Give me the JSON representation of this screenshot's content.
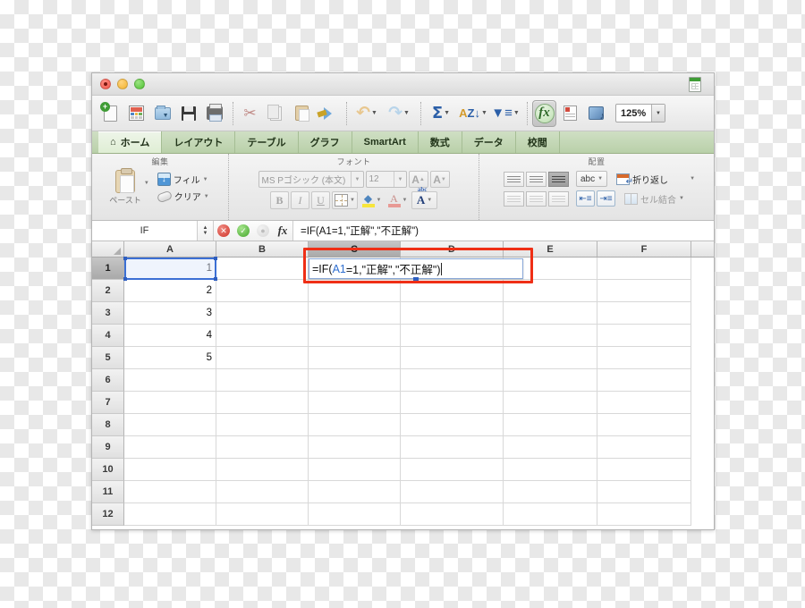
{
  "window": {
    "traffic_lights": [
      "close",
      "minimize",
      "zoom"
    ],
    "proxy_icon": "excel-document-icon"
  },
  "toolbar": {
    "items": [
      {
        "name": "new-document-button",
        "icon": "new-document-icon",
        "label": ""
      },
      {
        "name": "template-gallery-button",
        "icon": "gallery-icon",
        "label": ""
      },
      {
        "name": "open-button",
        "icon": "open-folder-icon",
        "label": ""
      },
      {
        "name": "save-button",
        "icon": "save-icon",
        "label": ""
      },
      {
        "name": "print-button",
        "icon": "print-icon",
        "label": ""
      },
      {
        "name": "cut-button",
        "icon": "scissors-icon",
        "label": ""
      },
      {
        "name": "copy-button",
        "icon": "copy-icon",
        "label": ""
      },
      {
        "name": "paste-button",
        "icon": "paste-icon",
        "label": ""
      },
      {
        "name": "format-painter-button",
        "icon": "paintbrush-icon",
        "label": ""
      },
      {
        "name": "undo-button",
        "icon": "undo-arrow-icon",
        "label": ""
      },
      {
        "name": "redo-button",
        "icon": "redo-arrow-icon",
        "label": ""
      },
      {
        "name": "autosum-button",
        "icon": "sigma-icon",
        "label": ""
      },
      {
        "name": "sort-button",
        "icon": "sort-az-icon",
        "label": ""
      },
      {
        "name": "filter-button",
        "icon": "funnel-icon",
        "label": ""
      },
      {
        "name": "formula-builder-button",
        "icon": "fx-icon",
        "label": ""
      },
      {
        "name": "toolbox-button",
        "icon": "toolbox-icon",
        "label": ""
      },
      {
        "name": "media-browser-button",
        "icon": "media-browser-icon",
        "label": ""
      }
    ],
    "zoom_value": "125%"
  },
  "ribbon": {
    "tabs": [
      {
        "label": "ホーム",
        "active": true,
        "icon": "home-icon"
      },
      {
        "label": "レイアウト",
        "active": false
      },
      {
        "label": "テーブル",
        "active": false
      },
      {
        "label": "グラフ",
        "active": false
      },
      {
        "label": "SmartArt",
        "active": false
      },
      {
        "label": "数式",
        "active": false
      },
      {
        "label": "データ",
        "active": false
      },
      {
        "label": "校閲",
        "active": false
      }
    ],
    "groups": {
      "edit": {
        "title": "編集",
        "paste_label": "ペースト",
        "fill_label": "フィル",
        "clear_label": "クリア"
      },
      "font": {
        "title": "フォント",
        "font_name": "MS Pゴシック (本文)",
        "font_size": "12",
        "grow_label": "A",
        "shrink_label": "A",
        "bold_label": "B",
        "italic_label": "I",
        "underline_label": "U"
      },
      "alignment": {
        "title": "配置",
        "orientation_label": "abc",
        "wrap_label": "折り返し",
        "merge_label": "セル結合"
      }
    }
  },
  "formula_bar": {
    "name_box": "IF",
    "cancel_icon": "cancel-x-icon",
    "accept_icon": "accept-check-icon",
    "fx_icon": "fx-icon",
    "formula": "=IF(A1=1,\"正解\",\"不正解\")"
  },
  "sheet": {
    "columns": [
      "A",
      "B",
      "C",
      "D",
      "E",
      "F"
    ],
    "selected_column": "C",
    "selected_row": "1",
    "rows": [
      {
        "num": "1",
        "cells": [
          "1",
          "",
          "",
          "",
          "",
          ""
        ]
      },
      {
        "num": "2",
        "cells": [
          "2",
          "",
          "",
          "",
          "",
          ""
        ]
      },
      {
        "num": "3",
        "cells": [
          "3",
          "",
          "",
          "",
          "",
          ""
        ]
      },
      {
        "num": "4",
        "cells": [
          "4",
          "",
          "",
          "",
          "",
          ""
        ]
      },
      {
        "num": "5",
        "cells": [
          "5",
          "",
          "",
          "",
          "",
          ""
        ]
      },
      {
        "num": "6",
        "cells": [
          "",
          "",
          "",
          "",
          "",
          ""
        ]
      },
      {
        "num": "7",
        "cells": [
          "",
          "",
          "",
          "",
          "",
          ""
        ]
      },
      {
        "num": "8",
        "cells": [
          "",
          "",
          "",
          "",
          "",
          ""
        ]
      },
      {
        "num": "9",
        "cells": [
          "",
          "",
          "",
          "",
          "",
          ""
        ]
      },
      {
        "num": "10",
        "cells": [
          "",
          "",
          "",
          "",
          "",
          ""
        ]
      },
      {
        "num": "11",
        "cells": [
          "",
          "",
          "",
          "",
          "",
          ""
        ]
      },
      {
        "num": "12",
        "cells": [
          "",
          "",
          "",
          "",
          "",
          ""
        ]
      }
    ],
    "editing_cell": {
      "address": "C1",
      "prefix": "=IF(",
      "reference": "A1",
      "suffix": "=1,\"正解\",\"不正解\")"
    },
    "reference_selection": "A1"
  },
  "annotation": {
    "shape": "rectangle",
    "color": "#ef2f16"
  }
}
